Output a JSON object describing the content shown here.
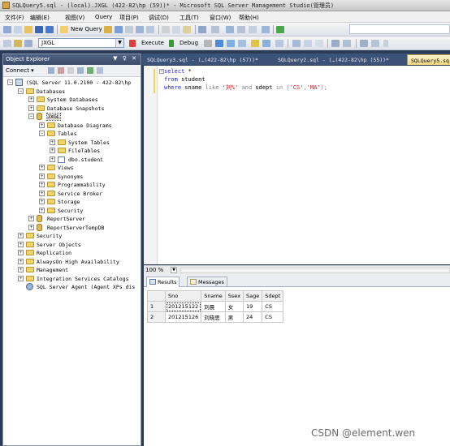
{
  "window": {
    "title": "SQLQuery5.sql - (local).JXGL (422-82\\hp (59))* - Microsoft SQL Server Management Studio(管理员)"
  },
  "menu": [
    "文件(F)",
    "编辑(E)",
    "视图(V)",
    "Query",
    "项目(P)",
    "调试(D)",
    "工具(T)",
    "窗口(W)",
    "帮助(H)"
  ],
  "toolbar": {
    "new_query": "New Query",
    "database": "JXGL",
    "execute": "Execute",
    "debug": "Debug"
  },
  "object_explorer": {
    "title": "Object Explorer",
    "header_controls": "▼ ♀ ✕",
    "connect": "Connect ▾",
    "tree": [
      {
        "label": "(SQL Server 11.0.2100 - 422-82\\hp",
        "level": 0,
        "expander": "−",
        "icon": "server",
        "row": 0
      },
      {
        "label": "Databases",
        "level": 1,
        "expander": "−",
        "icon": "folder",
        "row": 1
      },
      {
        "label": "System Databases",
        "level": 2,
        "expander": "+",
        "icon": "folder",
        "row": 2
      },
      {
        "label": "Database Snapshots",
        "level": 2,
        "expander": "+",
        "icon": "folder",
        "row": 3
      },
      {
        "label": "JXGL",
        "level": 2,
        "expander": "−",
        "icon": "database",
        "row": 4,
        "selected": true
      },
      {
        "label": "Database Diagrams",
        "level": 3,
        "expander": "+",
        "icon": "folder",
        "row": 5
      },
      {
        "label": "Tables",
        "level": 3,
        "expander": "−",
        "icon": "folder",
        "row": 6
      },
      {
        "label": "System Tables",
        "level": 4,
        "expander": "+",
        "icon": "folder",
        "row": 7
      },
      {
        "label": "FileTables",
        "level": 4,
        "expander": "+",
        "icon": "folder",
        "row": 8
      },
      {
        "label": "dbo.student",
        "level": 4,
        "expander": "+",
        "icon": "table",
        "row": 9
      },
      {
        "label": "Views",
        "level": 3,
        "expander": "+",
        "icon": "folder",
        "row": 10
      },
      {
        "label": "Synonyms",
        "level": 3,
        "expander": "+",
        "icon": "folder",
        "row": 11
      },
      {
        "label": "Programmability",
        "level": 3,
        "expander": "+",
        "icon": "folder",
        "row": 12
      },
      {
        "label": "Service Broker",
        "level": 3,
        "expander": "+",
        "icon": "folder",
        "row": 13
      },
      {
        "label": "Storage",
        "level": 3,
        "expander": "+",
        "icon": "folder",
        "row": 14
      },
      {
        "label": "Security",
        "level": 3,
        "expander": "+",
        "icon": "folder",
        "row": 15
      },
      {
        "label": "ReportServer",
        "level": 2,
        "expander": "+",
        "icon": "database",
        "row": 16
      },
      {
        "label": "ReportServerTempDB",
        "level": 2,
        "expander": "+",
        "icon": "database",
        "row": 17
      },
      {
        "label": "Security",
        "level": 1,
        "expander": "+",
        "icon": "folder",
        "row": 18
      },
      {
        "label": "Server Objects",
        "level": 1,
        "expander": "+",
        "icon": "folder",
        "row": 19
      },
      {
        "label": "Replication",
        "level": 1,
        "expander": "+",
        "icon": "folder",
        "row": 20
      },
      {
        "label": "AlwaysOn High Availability",
        "level": 1,
        "expander": "+",
        "icon": "folder",
        "row": 21
      },
      {
        "label": "Management",
        "level": 1,
        "expander": "+",
        "icon": "folder",
        "row": 22
      },
      {
        "label": "Integration Services Catalogs",
        "level": 1,
        "expander": "+",
        "icon": "folder",
        "row": 23
      },
      {
        "label": "SQL Server Agent (Agent XPs dis",
        "level": 1,
        "expander": "",
        "icon": "agent",
        "row": 24
      }
    ]
  },
  "doc_tabs": [
    {
      "label": "SQLQuery3.sql - (…(422-82\\hp (57))*",
      "active": false
    },
    {
      "label": "SQLQuery2.sql - (…(422-82\\hp (55))*",
      "active": false
    },
    {
      "label": "SQLQuery5.sq",
      "active": true
    }
  ],
  "editor": {
    "lines": [
      [
        {
          "t": "select",
          "c": "kw"
        },
        {
          "t": " *",
          "c": ""
        }
      ],
      [
        {
          "t": "from",
          "c": "kw"
        },
        {
          "t": " student",
          "c": ""
        }
      ],
      [
        {
          "t": "where",
          "c": "kw"
        },
        {
          "t": " sname ",
          "c": ""
        },
        {
          "t": "like",
          "c": "gray"
        },
        {
          "t": " ",
          "c": ""
        },
        {
          "t": "'刘%'",
          "c": "str"
        },
        {
          "t": " ",
          "c": ""
        },
        {
          "t": "and",
          "c": "gray"
        },
        {
          "t": " sdept ",
          "c": ""
        },
        {
          "t": "in",
          "c": "gray"
        },
        {
          "t": " (",
          "c": "gray"
        },
        {
          "t": "'CS'",
          "c": "str"
        },
        {
          "t": ",",
          "c": "gray"
        },
        {
          "t": "'MA'",
          "c": "str"
        },
        {
          "t": ");",
          "c": "gray"
        }
      ]
    ],
    "zoom": "100 %"
  },
  "results": {
    "tabs": [
      "Results",
      "Messages"
    ],
    "columns": [
      "Sno",
      "Sname",
      "Ssex",
      "Sage",
      "Sdept"
    ],
    "rows": [
      {
        "n": "1",
        "cells": [
          "201215122",
          "刘晨",
          "女",
          "19",
          "CS"
        ]
      },
      {
        "n": "2",
        "cells": [
          "201215126",
          "刘晓思",
          "男",
          "24",
          "CS"
        ]
      }
    ]
  },
  "watermark": "CSDN @element.wen"
}
